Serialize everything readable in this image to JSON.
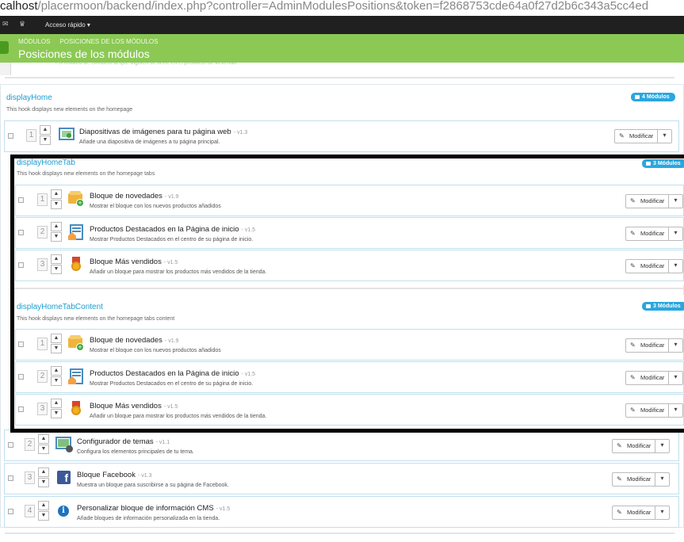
{
  "browser": {
    "url_host": "calhost",
    "url_rest": "/placermoon/backend/index.php?controller=AdminModulesPositions&token=f2868753cde64a0f27d2b6c343a5cc4ed"
  },
  "topbar": {
    "quick_access": "Acceso rápido ▾",
    "mail_icon": "mail-icon",
    "trophy_icon": "trophy-icon"
  },
  "breadcrumb": [
    "MÓDULOS",
    "POSICIONES DE LOS MÓDULOS"
  ],
  "page_title": "Posiciones de los módulos",
  "peek_text": "Formulario de contacto al que alguien se tiene en el producto de la tienda",
  "modify_label": "Modificar",
  "hooks": [
    {
      "name": "displayHome",
      "description": "This hook displays new elements on the homepage",
      "badge": "4 Módulos",
      "modules": [
        {
          "position": "1",
          "name": "Diapositivas de imágenes para tu página web",
          "version": "- v1.3",
          "description": "Añade una diapositiva de imágenes a tu página principal.",
          "icon": "slideshow-icon"
        },
        {
          "position": "2",
          "name": "Configurador de temas",
          "version": "- v1.1",
          "description": "Configura los elementos principales de tu tema.",
          "icon": "theme-configurator-icon"
        },
        {
          "position": "3",
          "name": "Bloque Facebook",
          "version": "- v1.3",
          "description": "Muestra un bloque para suscribirse a su página de Facebook.",
          "icon": "facebook-icon"
        },
        {
          "position": "4",
          "name": "Personalizar bloque de información CMS",
          "version": "- v1.5",
          "description": "Añade bloques de información personalizada en la tienda.",
          "icon": "info-icon"
        }
      ]
    },
    {
      "name": "displayHomeTab",
      "description": "This hook displays new elements on the homepage tabs",
      "badge": "3 Módulos",
      "modules": [
        {
          "position": "1",
          "name": "Bloque de novedades",
          "version": "- v1.9",
          "description": "Mostrar el bloque con los nuevos productos añadidos",
          "icon": "new-products-icon"
        },
        {
          "position": "2",
          "name": "Productos Destacados en la Página de inicio",
          "version": "- v1.5",
          "description": "Mostrar Productos Destacados en el centro de su página de inicio.",
          "icon": "featured-products-icon"
        },
        {
          "position": "3",
          "name": "Bloque Más vendidos",
          "version": "- v1.5",
          "description": "Añadir un bloque para mostrar los productos más vendidos de la tienda.",
          "icon": "best-sellers-icon"
        }
      ]
    },
    {
      "name": "displayHomeTabContent",
      "description": "This hook displays new elements on the homepage tabs content",
      "badge": "3 Módulos",
      "modules": [
        {
          "position": "1",
          "name": "Bloque de novedades",
          "version": "- v1.9",
          "description": "Mostrar el bloque con los nuevos productos añadidos",
          "icon": "new-products-icon"
        },
        {
          "position": "2",
          "name": "Productos Destacados en la Página de inicio",
          "version": "- v1.5",
          "description": "Mostrar Productos Destacados en el centro de su página de inicio.",
          "icon": "featured-products-icon"
        },
        {
          "position": "3",
          "name": "Bloque Más vendidos",
          "version": "- v1.5",
          "description": "Añadir un bloque para mostrar los productos más vendidos de la tienda.",
          "icon": "best-sellers-icon"
        }
      ]
    }
  ]
}
